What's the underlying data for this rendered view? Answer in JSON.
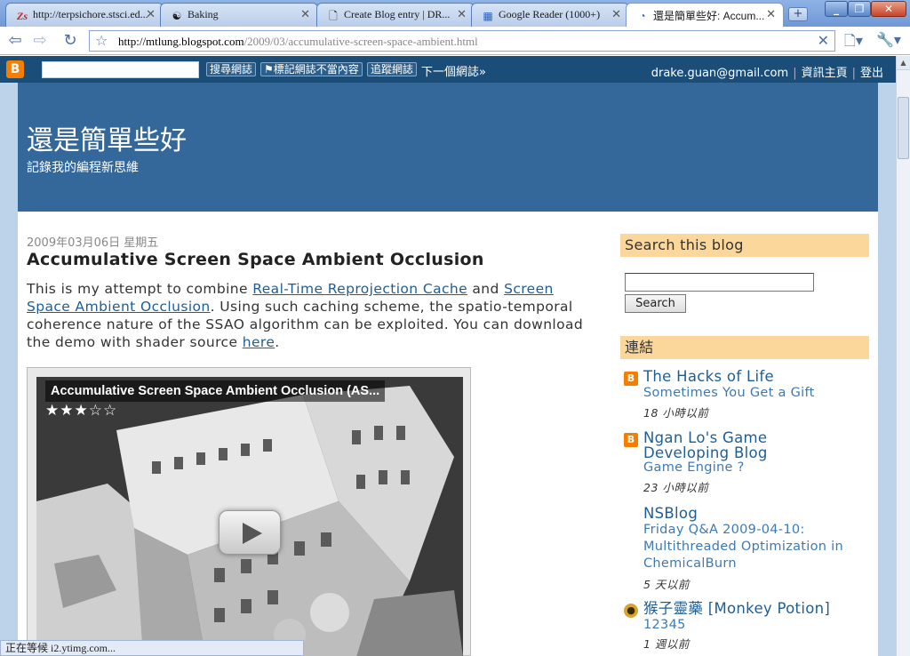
{
  "browser": {
    "tabs": [
      {
        "title": "http://terpsichore.stsci.ed...",
        "icon": "stsci-favicon"
      },
      {
        "title": "Baking",
        "icon": "yin-yang-favicon"
      },
      {
        "title": "Create Blog entry | DR...",
        "icon": "page-favicon"
      },
      {
        "title": "Google Reader (1000+)",
        "icon": "rss-favicon"
      },
      {
        "title": "還是簡單些好: Accum...",
        "icon": "loading-favicon"
      }
    ],
    "url_host": "http://mtlung.blogspot.com",
    "url_path": "/2009/03/accumulative-screen-space-ambient.html",
    "status_text": "正在等候 i2.ytimg.com..."
  },
  "blogger_nav": {
    "search_blog": "搜尋網誌",
    "flag_blog": "標記網誌不當內容",
    "follow_blog": "追蹤網誌",
    "next_blog": "下一個網誌»",
    "email": "drake.guan@gmail.com",
    "dashboard": "資訊主頁",
    "sign_out": "登出",
    "separator": "|"
  },
  "blog": {
    "title": "還是簡單些好",
    "description": "記錄我的編程新思維"
  },
  "post": {
    "date": "2009年03月06日 星期五",
    "title": "Accumulative Screen Space Ambient Occlusion",
    "body_1": "This is my attempt to combine ",
    "link_1": "Real-Time Reprojection Cache",
    "body_2": " and ",
    "link_2": "Screen Space Ambient Occlusion",
    "body_3": ". Using such caching scheme, the spatio-temporal coherence nature of the SSAO algorithm can be exploited. You can download the demo with shader source ",
    "link_3": "here",
    "body_4": "."
  },
  "video": {
    "title": "Accumulative Screen Space Ambient Occlusion (AS...",
    "rating": 3,
    "max_rating": 5
  },
  "sidebar": {
    "search_title": "Search this blog",
    "search_button": "Search",
    "links_title": "連結",
    "feeds": [
      {
        "name": "The Hacks of Life",
        "post": "Sometimes You Get a Gift",
        "time": "18 小時以前",
        "icon": "blogger-icon"
      },
      {
        "name": "Ngan Lo's Game Developing Blog",
        "post": "Game Engine ?",
        "time": "23 小時以前",
        "icon": "blogger-icon"
      },
      {
        "name": "NSBlog",
        "post": "Friday Q&A 2009-04-10: Multithreaded Optimization in ChemicalBurn",
        "time": "5 天以前",
        "icon": ""
      },
      {
        "name": "猴子靈藥 [Monkey Potion]",
        "post": "12345",
        "time": "1 週以前",
        "icon": "monkey-icon"
      }
    ]
  },
  "colors": {
    "header": "#35689a",
    "navbar": "#1b4d79",
    "sidebar_title": "#fbd79b",
    "link": "#1f5e94"
  }
}
